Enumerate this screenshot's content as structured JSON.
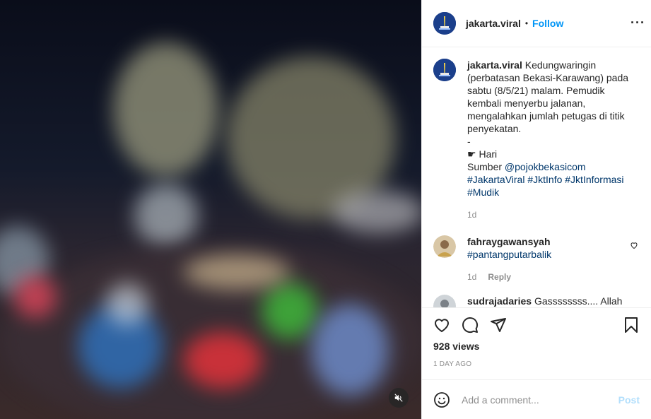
{
  "header": {
    "username": "jakarta.viral",
    "separator": "•",
    "follow_label": "Follow",
    "more_label": "···"
  },
  "caption": {
    "username": "jakarta.viral",
    "text_lines": [
      "Kedungwaringin",
      "(perbatasan Bekasi-Karawang) pada",
      "sabtu (8/5/21) malam. Pemudik",
      "kembali menyerbu jalanan,",
      "mengalahkan jumlah petugas di titik",
      "penyekatan.",
      "-",
      "Hari"
    ],
    "emoji": "☛",
    "source_prefix": "Sumber ",
    "source_mention": "@pojokbekasicom",
    "hashtags_line1": [
      "#JakartaViral",
      "#JktInfo",
      "#JktInformasi"
    ],
    "hashtags_line2": [
      "#Mudik"
    ],
    "time": "1d"
  },
  "comments": [
    {
      "username": "fahraygawansyah",
      "text": "#pantangputarbalik",
      "time": "1d",
      "reply_label": "Reply"
    },
    {
      "username": "sudrajadaries",
      "text": "Gassssssss.... Allah"
    }
  ],
  "stats": {
    "views": "928 views",
    "date": "1 DAY AGO"
  },
  "composer": {
    "placeholder": "Add a comment...",
    "post_label": "Post"
  },
  "colors": {
    "accent": "#0095f6",
    "link": "#00376b",
    "muted": "#8e8e8e",
    "post_disabled": "#b2dffc"
  }
}
